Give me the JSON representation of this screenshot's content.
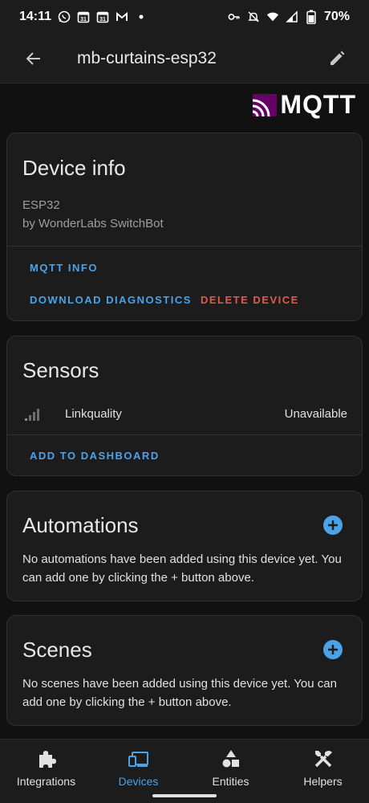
{
  "status_bar": {
    "time": "14:11",
    "battery": "70%",
    "left_icons": [
      "whatsapp-icon",
      "calendar-icon",
      "calendar-icon",
      "gmail-icon",
      "dot-icon"
    ],
    "right_icons": [
      "key-icon",
      "mute-icon",
      "wifi-icon",
      "signal-icon",
      "battery-icon"
    ]
  },
  "app_bar": {
    "title": "mb-curtains-esp32"
  },
  "brand": {
    "text": "MQTT",
    "accent_color": "#660066"
  },
  "device_info": {
    "title": "Device info",
    "model": "ESP32",
    "manufacturer": "by WonderLabs SwitchBot",
    "actions": {
      "mqtt_info": "MQTT INFO",
      "download_diagnostics": "DOWNLOAD DIAGNOSTICS",
      "delete_device": "DELETE DEVICE"
    }
  },
  "sensors": {
    "title": "Sensors",
    "items": [
      {
        "name": "Linkquality",
        "value": "Unavailable",
        "icon": "signal-bars-icon"
      }
    ],
    "add_to_dashboard": "ADD TO DASHBOARD"
  },
  "automations": {
    "title": "Automations",
    "description": "No automations have been added using this device yet. You can add one by clicking the + button above."
  },
  "scenes": {
    "title": "Scenes",
    "description": "No scenes have been added using this device yet. You can add one by clicking the + button above."
  },
  "bottom_nav": {
    "items": [
      {
        "label": "Integrations",
        "icon": "puzzle-icon",
        "active": false
      },
      {
        "label": "Devices",
        "icon": "devices-icon",
        "active": true
      },
      {
        "label": "Entities",
        "icon": "shapes-icon",
        "active": false
      },
      {
        "label": "Helpers",
        "icon": "tools-icon",
        "active": false
      }
    ]
  },
  "colors": {
    "background": "#111111",
    "card": "#1c1c1c",
    "primary": "#4aa3e8",
    "danger": "#e05a4f",
    "text": "#e1e1e1",
    "secondary_text": "#9e9e9e"
  }
}
